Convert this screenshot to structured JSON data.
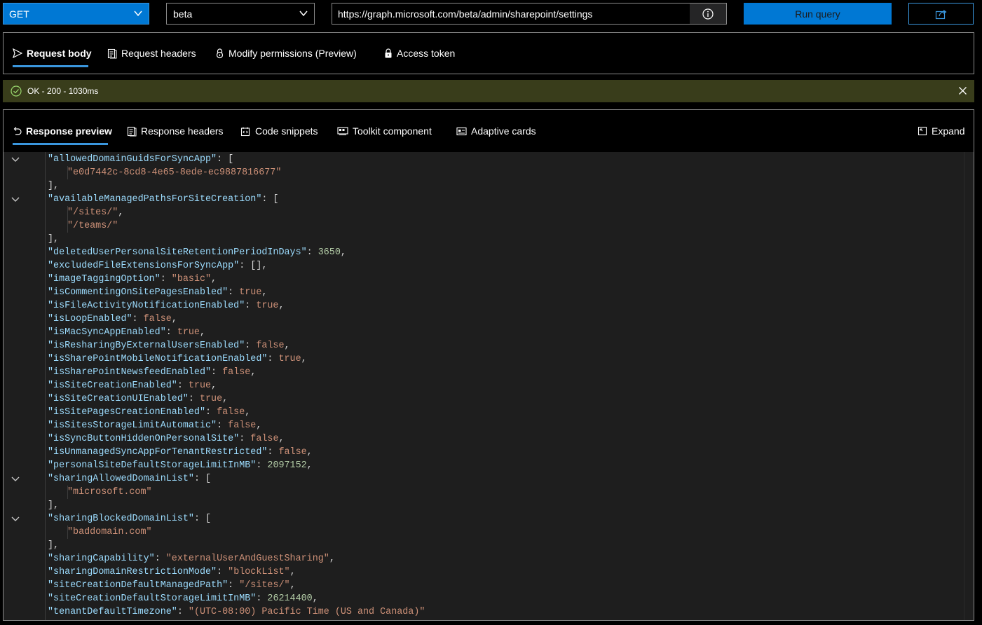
{
  "query": {
    "method": "GET",
    "version": "beta",
    "url": "https://graph.microsoft.com/beta/admin/sharepoint/settings",
    "run_label": "Run query"
  },
  "request_tabs": [
    {
      "label": "Request body",
      "icon": "send-icon"
    },
    {
      "label": "Request headers",
      "icon": "document-icon"
    },
    {
      "label": "Modify permissions (Preview)",
      "icon": "lock-icon"
    },
    {
      "label": "Access token",
      "icon": "key-icon"
    }
  ],
  "status": {
    "text": "OK - 200 - 1030ms",
    "color": "#393d1b"
  },
  "response_tabs": [
    {
      "label": "Response preview",
      "icon": "undo-icon"
    },
    {
      "label": "Response headers",
      "icon": "document-icon"
    },
    {
      "label": "Code snippets",
      "icon": "code-icon"
    },
    {
      "label": "Toolkit component",
      "icon": "toolkit-icon"
    },
    {
      "label": "Adaptive cards",
      "icon": "card-icon"
    }
  ],
  "expand_label": "Expand",
  "response_lines": [
    {
      "indent": 1,
      "fold": true,
      "tokens": [
        [
          "k",
          "\"allowedDomainGuidsForSyncApp\""
        ],
        [
          "p",
          ": ["
        ]
      ]
    },
    {
      "indent": 2,
      "fold": false,
      "tokens": [
        [
          "s",
          "\"e0d7442c-8cd8-4e65-8ede-ec9887816677\""
        ]
      ]
    },
    {
      "indent": 1,
      "fold": false,
      "tokens": [
        [
          "p",
          "],"
        ]
      ]
    },
    {
      "indent": 1,
      "fold": true,
      "tokens": [
        [
          "k",
          "\"availableManagedPathsForSiteCreation\""
        ],
        [
          "p",
          ": ["
        ]
      ]
    },
    {
      "indent": 2,
      "fold": false,
      "tokens": [
        [
          "s",
          "\"/sites/\""
        ],
        [
          "p",
          ","
        ]
      ]
    },
    {
      "indent": 2,
      "fold": false,
      "tokens": [
        [
          "s",
          "\"/teams/\""
        ]
      ]
    },
    {
      "indent": 1,
      "fold": false,
      "tokens": [
        [
          "p",
          "],"
        ]
      ]
    },
    {
      "indent": 1,
      "fold": false,
      "tokens": [
        [
          "k",
          "\"deletedUserPersonalSiteRetentionPeriodInDays\""
        ],
        [
          "p",
          ": "
        ],
        [
          "n",
          "3650"
        ],
        [
          "p",
          ","
        ]
      ]
    },
    {
      "indent": 1,
      "fold": false,
      "tokens": [
        [
          "k",
          "\"excludedFileExtensionsForSyncApp\""
        ],
        [
          "p",
          ": [],"
        ]
      ]
    },
    {
      "indent": 1,
      "fold": false,
      "tokens": [
        [
          "k",
          "\"imageTaggingOption\""
        ],
        [
          "p",
          ": "
        ],
        [
          "s",
          "\"basic\""
        ],
        [
          "p",
          ","
        ]
      ]
    },
    {
      "indent": 1,
      "fold": false,
      "tokens": [
        [
          "k",
          "\"isCommentingOnSitePagesEnabled\""
        ],
        [
          "p",
          ": "
        ],
        [
          "s",
          "true"
        ],
        [
          "p",
          ","
        ]
      ]
    },
    {
      "indent": 1,
      "fold": false,
      "tokens": [
        [
          "k",
          "\"isFileActivityNotificationEnabled\""
        ],
        [
          "p",
          ": "
        ],
        [
          "s",
          "true"
        ],
        [
          "p",
          ","
        ]
      ]
    },
    {
      "indent": 1,
      "fold": false,
      "tokens": [
        [
          "k",
          "\"isLoopEnabled\""
        ],
        [
          "p",
          ": "
        ],
        [
          "s",
          "false"
        ],
        [
          "p",
          ","
        ]
      ]
    },
    {
      "indent": 1,
      "fold": false,
      "tokens": [
        [
          "k",
          "\"isMacSyncAppEnabled\""
        ],
        [
          "p",
          ": "
        ],
        [
          "s",
          "true"
        ],
        [
          "p",
          ","
        ]
      ]
    },
    {
      "indent": 1,
      "fold": false,
      "tokens": [
        [
          "k",
          "\"isResharingByExternalUsersEnabled\""
        ],
        [
          "p",
          ": "
        ],
        [
          "s",
          "false"
        ],
        [
          "p",
          ","
        ]
      ]
    },
    {
      "indent": 1,
      "fold": false,
      "tokens": [
        [
          "k",
          "\"isSharePointMobileNotificationEnabled\""
        ],
        [
          "p",
          ": "
        ],
        [
          "s",
          "true"
        ],
        [
          "p",
          ","
        ]
      ]
    },
    {
      "indent": 1,
      "fold": false,
      "tokens": [
        [
          "k",
          "\"isSharePointNewsfeedEnabled\""
        ],
        [
          "p",
          ": "
        ],
        [
          "s",
          "false"
        ],
        [
          "p",
          ","
        ]
      ]
    },
    {
      "indent": 1,
      "fold": false,
      "tokens": [
        [
          "k",
          "\"isSiteCreationEnabled\""
        ],
        [
          "p",
          ": "
        ],
        [
          "s",
          "true"
        ],
        [
          "p",
          ","
        ]
      ]
    },
    {
      "indent": 1,
      "fold": false,
      "tokens": [
        [
          "k",
          "\"isSiteCreationUIEnabled\""
        ],
        [
          "p",
          ": "
        ],
        [
          "s",
          "true"
        ],
        [
          "p",
          ","
        ]
      ]
    },
    {
      "indent": 1,
      "fold": false,
      "tokens": [
        [
          "k",
          "\"isSitePagesCreationEnabled\""
        ],
        [
          "p",
          ": "
        ],
        [
          "s",
          "false"
        ],
        [
          "p",
          ","
        ]
      ]
    },
    {
      "indent": 1,
      "fold": false,
      "tokens": [
        [
          "k",
          "\"isSitesStorageLimitAutomatic\""
        ],
        [
          "p",
          ": "
        ],
        [
          "s",
          "false"
        ],
        [
          "p",
          ","
        ]
      ]
    },
    {
      "indent": 1,
      "fold": false,
      "tokens": [
        [
          "k",
          "\"isSyncButtonHiddenOnPersonalSite\""
        ],
        [
          "p",
          ": "
        ],
        [
          "s",
          "false"
        ],
        [
          "p",
          ","
        ]
      ]
    },
    {
      "indent": 1,
      "fold": false,
      "tokens": [
        [
          "k",
          "\"isUnmanagedSyncAppForTenantRestricted\""
        ],
        [
          "p",
          ": "
        ],
        [
          "s",
          "false"
        ],
        [
          "p",
          ","
        ]
      ]
    },
    {
      "indent": 1,
      "fold": false,
      "tokens": [
        [
          "k",
          "\"personalSiteDefaultStorageLimitInMB\""
        ],
        [
          "p",
          ": "
        ],
        [
          "n",
          "2097152"
        ],
        [
          "p",
          ","
        ]
      ]
    },
    {
      "indent": 1,
      "fold": true,
      "tokens": [
        [
          "k",
          "\"sharingAllowedDomainList\""
        ],
        [
          "p",
          ": ["
        ]
      ]
    },
    {
      "indent": 2,
      "fold": false,
      "tokens": [
        [
          "s",
          "\"microsoft.com\""
        ]
      ]
    },
    {
      "indent": 1,
      "fold": false,
      "tokens": [
        [
          "p",
          "],"
        ]
      ]
    },
    {
      "indent": 1,
      "fold": true,
      "tokens": [
        [
          "k",
          "\"sharingBlockedDomainList\""
        ],
        [
          "p",
          ": ["
        ]
      ]
    },
    {
      "indent": 2,
      "fold": false,
      "tokens": [
        [
          "s",
          "\"baddomain.com\""
        ]
      ]
    },
    {
      "indent": 1,
      "fold": false,
      "tokens": [
        [
          "p",
          "],"
        ]
      ]
    },
    {
      "indent": 1,
      "fold": false,
      "tokens": [
        [
          "k",
          "\"sharingCapability\""
        ],
        [
          "p",
          ": "
        ],
        [
          "s",
          "\"externalUserAndGuestSharing\""
        ],
        [
          "p",
          ","
        ]
      ]
    },
    {
      "indent": 1,
      "fold": false,
      "tokens": [
        [
          "k",
          "\"sharingDomainRestrictionMode\""
        ],
        [
          "p",
          ": "
        ],
        [
          "s",
          "\"blockList\""
        ],
        [
          "p",
          ","
        ]
      ]
    },
    {
      "indent": 1,
      "fold": false,
      "tokens": [
        [
          "k",
          "\"siteCreationDefaultManagedPath\""
        ],
        [
          "p",
          ": "
        ],
        [
          "s",
          "\"/sites/\""
        ],
        [
          "p",
          ","
        ]
      ]
    },
    {
      "indent": 1,
      "fold": false,
      "tokens": [
        [
          "k",
          "\"siteCreationDefaultStorageLimitInMB\""
        ],
        [
          "p",
          ": "
        ],
        [
          "n",
          "26214400"
        ],
        [
          "p",
          ","
        ]
      ]
    },
    {
      "indent": 1,
      "fold": false,
      "tokens": [
        [
          "k",
          "\"tenantDefaultTimezone\""
        ],
        [
          "p",
          ": "
        ],
        [
          "s",
          "\"(UTC-08:00) Pacific Time (US and Canada)\""
        ]
      ]
    }
  ],
  "colors": {
    "accent": "#0078d4",
    "status_bg": "#393d1b",
    "json_key": "#9cdcfe",
    "json_string": "#ce9178",
    "json_number": "#b5cea8"
  }
}
